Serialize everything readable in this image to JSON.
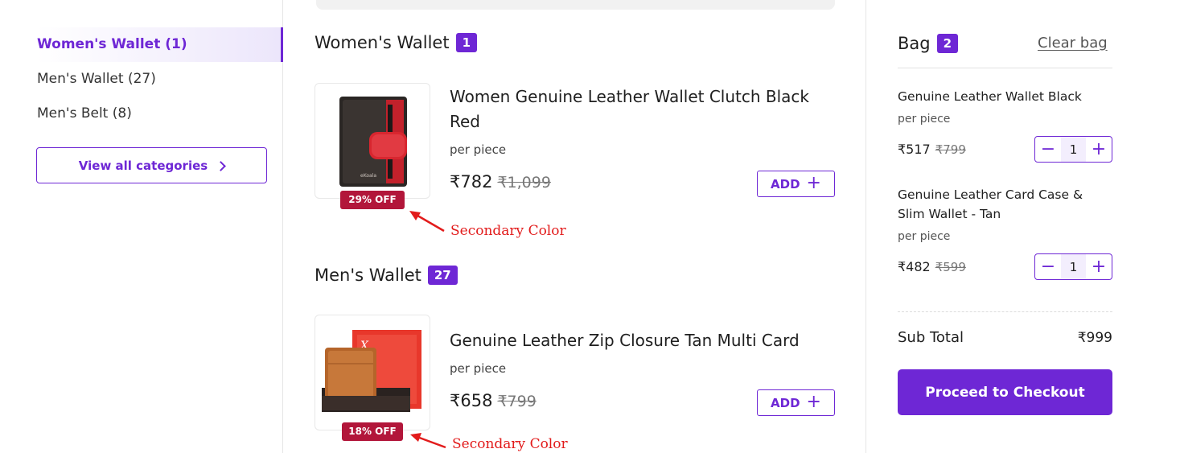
{
  "sidebar": {
    "categories": [
      {
        "label": "Women's Wallet (1)",
        "active": true
      },
      {
        "label": "Men's Wallet (27)",
        "active": false
      },
      {
        "label": "Men's Belt (8)",
        "active": false
      }
    ],
    "view_all_label": "View all categories"
  },
  "sections": [
    {
      "title": "Women's Wallet",
      "count": "1",
      "product": {
        "name": "Women Genuine Leather Wallet Clutch Black Red",
        "unit": "per piece",
        "price": "₹782",
        "mrp": "₹1,099",
        "discount": "29% OFF",
        "add_label": "ADD",
        "image": "black-red-wallet-image"
      },
      "annotation": "Secondary Color"
    },
    {
      "title": "Men's Wallet",
      "count": "27",
      "product": {
        "name": "Genuine Leather Zip Closure Tan Multi Card",
        "unit": "per piece",
        "price": "₹658",
        "mrp": "₹799",
        "discount": "18% OFF",
        "add_label": "ADD",
        "image": "tan-wallet-in-box-image"
      },
      "annotation": "Secondary Color"
    }
  ],
  "bag": {
    "title": "Bag",
    "count": "2",
    "clear_label": "Clear bag",
    "items": [
      {
        "name": "Genuine Leather Wallet Black",
        "unit": "per piece",
        "price": "₹517",
        "mrp": "₹799",
        "qty": "1",
        "minus": "−",
        "plus": "+"
      },
      {
        "name": "Genuine Leather Card Case & Slim Wallet - Tan",
        "unit": "per piece",
        "price": "₹482",
        "mrp": "₹599",
        "qty": "1",
        "minus": "−",
        "plus": "+"
      }
    ],
    "subtotal_label": "Sub Total",
    "subtotal_value": "₹999",
    "checkout_label": "Proceed to Checkout"
  },
  "colors": {
    "primary": "#6e27d5",
    "secondary": "#b2163a",
    "annotation": "#e21b1b"
  }
}
